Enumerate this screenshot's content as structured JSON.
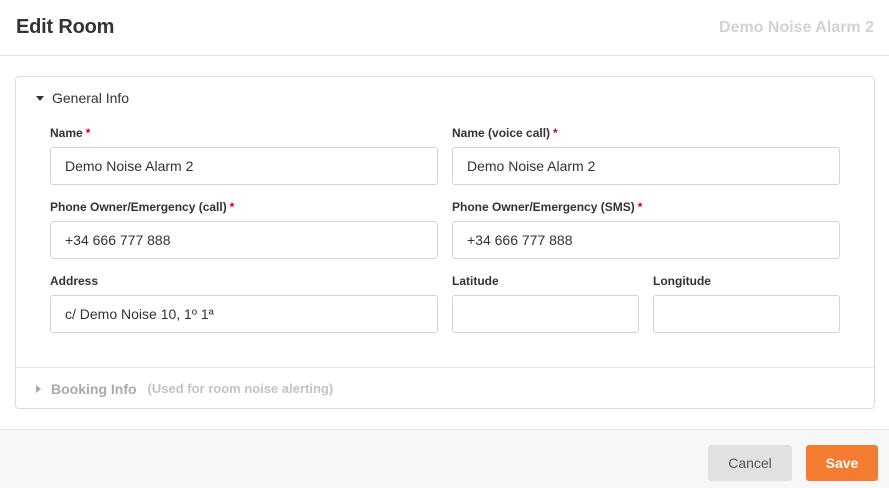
{
  "header": {
    "title": "Edit Room",
    "subtitle": "Demo Noise Alarm 2"
  },
  "general": {
    "section_title": "General Info",
    "name": {
      "label": "Name",
      "required": "*",
      "value": "Demo Noise Alarm 2"
    },
    "voice_name": {
      "label": "Name (voice call)",
      "required": "*",
      "value": "Demo Noise Alarm 2"
    },
    "phone_call": {
      "label": "Phone Owner/Emergency (call)",
      "required": "*",
      "value": "+34 666 777 888"
    },
    "phone_sms": {
      "label": "Phone Owner/Emergency (SMS)",
      "required": "*",
      "value": "+34 666 777 888"
    },
    "address": {
      "label": "Address",
      "value": "c/ Demo Noise 10, 1º 1ª"
    },
    "latitude": {
      "label": "Latitude",
      "value": ""
    },
    "longitude": {
      "label": "Longitude",
      "value": ""
    }
  },
  "booking": {
    "section_title": "Booking Info",
    "note": "(Used for room noise alerting)"
  },
  "footer": {
    "cancel_label": "Cancel",
    "save_label": "Save"
  },
  "colors": {
    "accent": "#f47c30",
    "required": "#d0021b",
    "muted": "#a9a9a9"
  },
  "icons": {
    "expanded": "caret-down-icon",
    "collapsed": "caret-right-icon"
  }
}
